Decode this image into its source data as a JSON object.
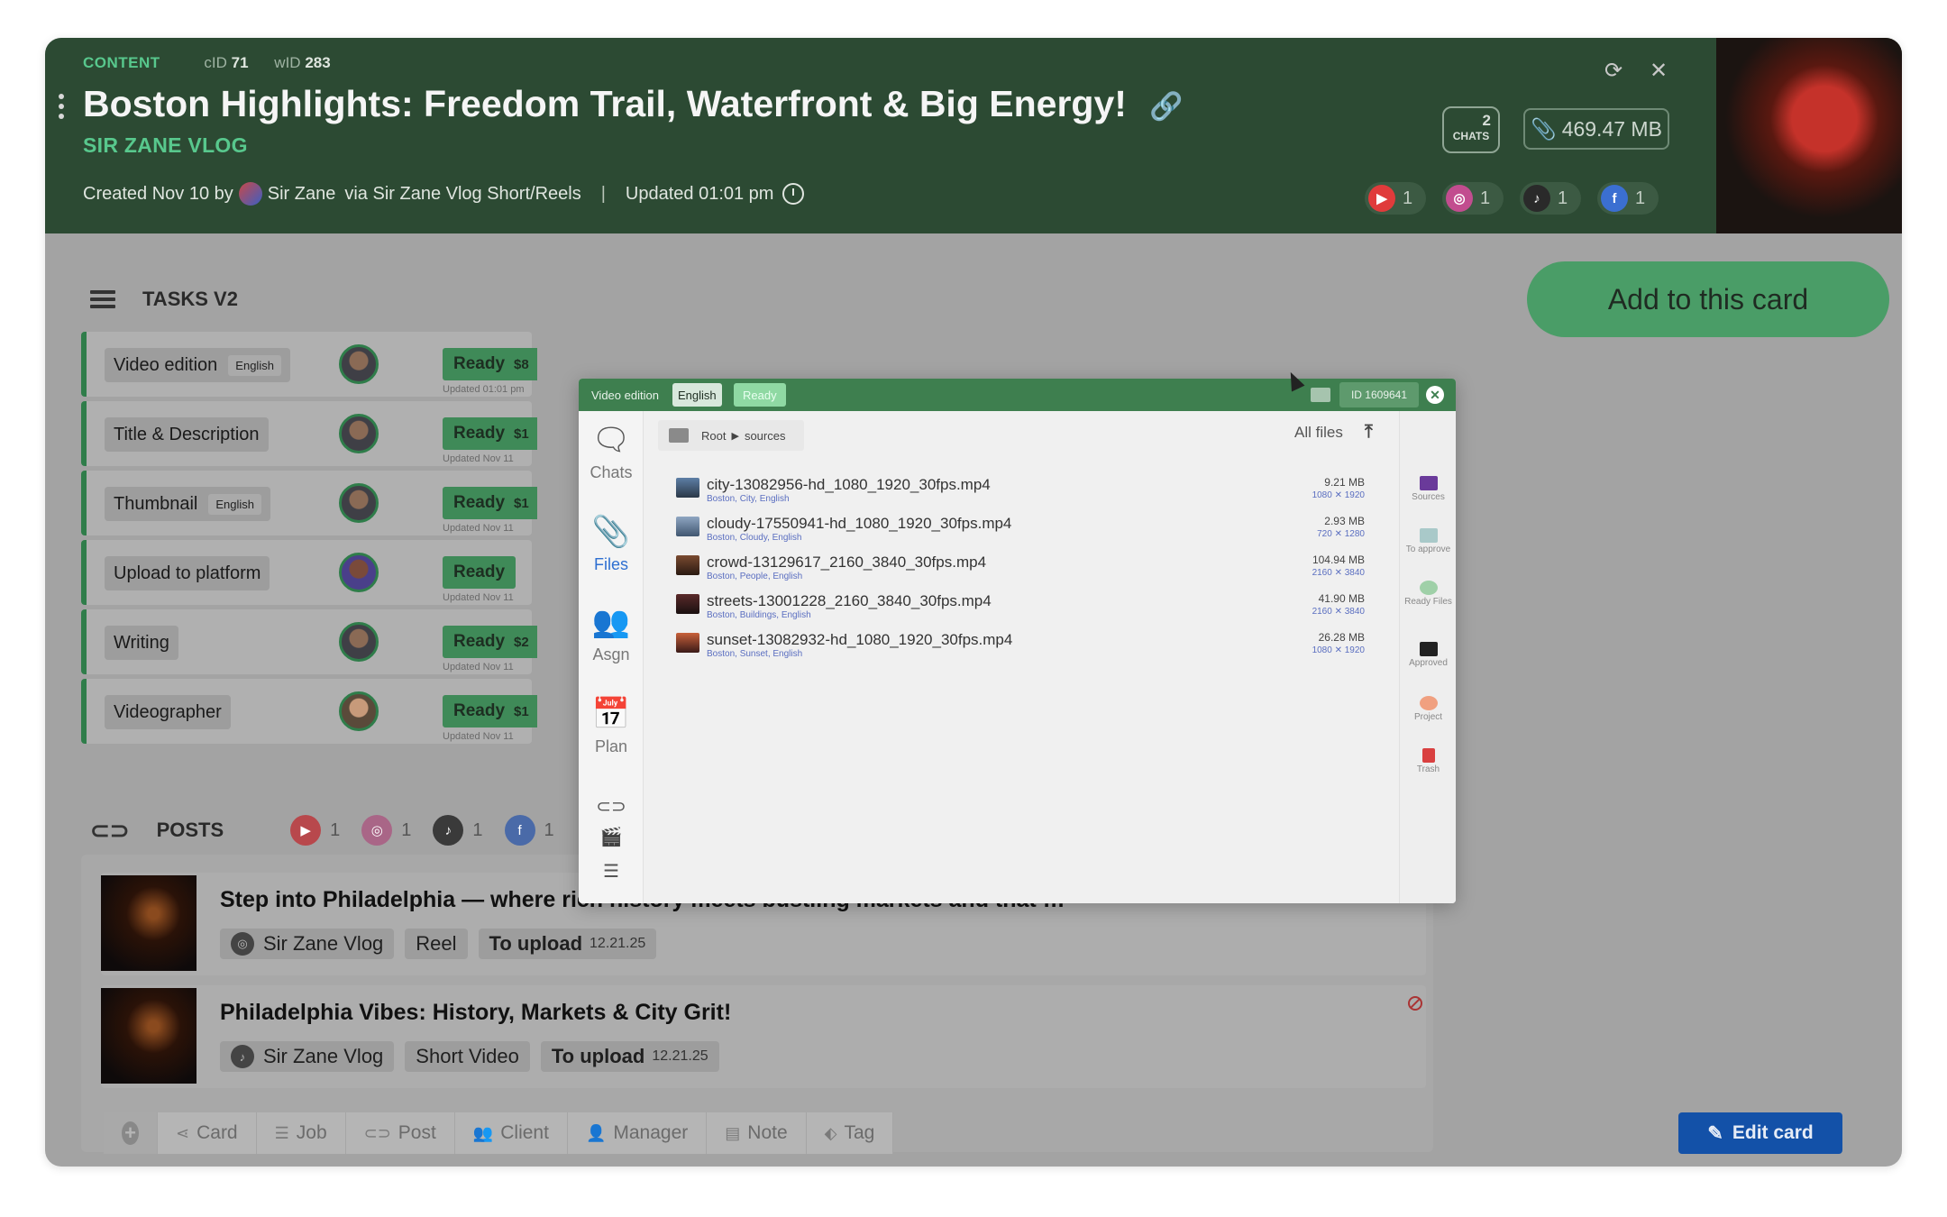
{
  "header": {
    "section_label": "CONTENT",
    "cid_label": "cID",
    "cid_value": "71",
    "wid_label": "wID",
    "wid_value": "283",
    "title": "Boston Highlights: Freedom Trail, Waterfront & Big Energy!",
    "channel": "SIR ZANE VLOG",
    "created": "Created Nov 10 by",
    "creator": "Sir Zane",
    "via": "via Sir Zane Vlog Short/Reels",
    "separator": "|",
    "updated": "Updated 01:01 pm",
    "chats_count": "2",
    "chats_label": "CHATS",
    "size": "469.47 MB",
    "platforms": [
      {
        "name": "youtube",
        "count": "1",
        "color": "#e03b3b"
      },
      {
        "name": "instagram",
        "count": "1",
        "color": "#c24d8f"
      },
      {
        "name": "tiktok",
        "count": "1",
        "color": "#2a2a2a"
      },
      {
        "name": "facebook",
        "count": "1",
        "color": "#3b6fd1"
      }
    ]
  },
  "tasks": {
    "heading": "TASKS V2",
    "add_button": "Add to this card",
    "items": [
      {
        "name": "Video edition",
        "lang": "English",
        "status": "Ready",
        "price": "$8",
        "updated": "Updated 01:01 pm"
      },
      {
        "name": "Title & Description",
        "lang": "",
        "status": "Ready",
        "price": "$1",
        "updated": "Updated Nov 11"
      },
      {
        "name": "Thumbnail",
        "lang": "English",
        "status": "Ready",
        "price": "$1",
        "updated": "Updated Nov 11"
      },
      {
        "name": "Upload to platform",
        "lang": "",
        "status": "Ready",
        "price": "",
        "updated": "Updated Nov 11"
      },
      {
        "name": "Writing",
        "lang": "",
        "status": "Ready",
        "price": "$2",
        "updated": "Updated Nov 11"
      },
      {
        "name": "Videographer",
        "lang": "",
        "status": "Ready",
        "price": "$1",
        "updated": "Updated Nov 11"
      }
    ]
  },
  "posts": {
    "heading": "POSTS",
    "counts": [
      "1",
      "1",
      "1",
      "1"
    ],
    "items": [
      {
        "title": "Step into Philadelphia — where rich history meets bustling markets and that …",
        "account": "Sir Zane Vlog",
        "type": "Reel",
        "status": "To upload",
        "date": "12.21.25"
      },
      {
        "title": "Philadelphia Vibes: History, Markets & City Grit!",
        "account": "Sir Zane Vlog",
        "type": "Short Video",
        "status": "To upload",
        "date": "12.21.25"
      }
    ]
  },
  "toolbar": {
    "items": [
      "Card",
      "Job",
      "Post",
      "Client",
      "Manager",
      "Note",
      "Tag"
    ],
    "edit_button": "Edit card"
  },
  "modal": {
    "task": "Video edition",
    "lang": "English",
    "status": "Ready",
    "id": "ID 1609641",
    "tabs": [
      "Chats",
      "Files",
      "Asgn",
      "Plan"
    ],
    "breadcrumb": [
      "Root",
      "sources"
    ],
    "filter": "All files",
    "files": [
      {
        "name": "city-13082956-hd_1080_1920_30fps.mp4",
        "tags": "Boston, City, English",
        "size": "9.21 MB",
        "res": "1080 ✕ 1920"
      },
      {
        "name": "cloudy-17550941-hd_1080_1920_30fps.mp4",
        "tags": "Boston, Cloudy, English",
        "size": "2.93 MB",
        "res": "720 ✕ 1280"
      },
      {
        "name": "crowd-13129617_2160_3840_30fps.mp4",
        "tags": "Boston, People, English",
        "size": "104.94 MB",
        "res": "2160 ✕ 3840"
      },
      {
        "name": "streets-13001228_2160_3840_30fps.mp4",
        "tags": "Boston, Buildings, English",
        "size": "41.90 MB",
        "res": "2160 ✕ 3840"
      },
      {
        "name": "sunset-13082932-hd_1080_1920_30fps.mp4",
        "tags": "Boston, Sunset, English",
        "size": "26.28 MB",
        "res": "1080 ✕ 1920"
      }
    ],
    "right_panel": [
      "Sources",
      "To approve",
      "Ready Files",
      "Approved",
      "Project",
      "Trash"
    ]
  }
}
